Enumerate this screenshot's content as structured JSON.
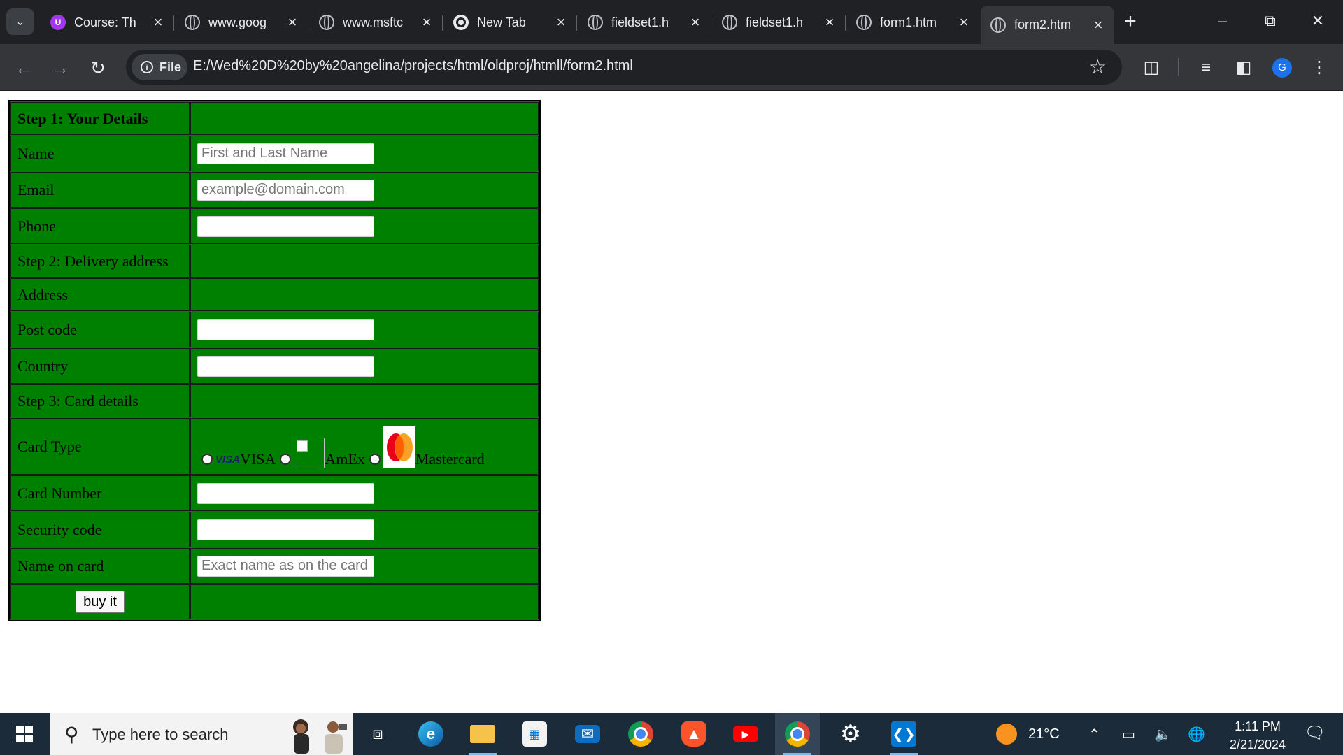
{
  "browser": {
    "tabs": [
      {
        "title": "Course: Th",
        "favicon": "udemy-icon"
      },
      {
        "title": "www.goog",
        "favicon": "globe-icon"
      },
      {
        "title": "www.msftc",
        "favicon": "globe-icon"
      },
      {
        "title": "New Tab",
        "favicon": "chrome-icon"
      },
      {
        "title": "fieldset1.h",
        "favicon": "globe-icon"
      },
      {
        "title": "fieldset1.h",
        "favicon": "globe-icon"
      },
      {
        "title": "form1.htm",
        "favicon": "globe-icon"
      },
      {
        "title": "form2.htm",
        "favicon": "globe-icon",
        "active": true
      }
    ],
    "new_tab_symbol": "+",
    "address": {
      "scheme_chip": "File",
      "url": "E:/Wed%20D%20by%20angelina/projects/html/oldproj/htmll/form2.html"
    },
    "profile_initial": "G"
  },
  "form": {
    "step1": "Step 1: Your Details",
    "name_label": "Name",
    "name_placeholder": "First and Last Name",
    "email_label": "Email",
    "email_placeholder": "example@domain.com",
    "phone_label": "Phone",
    "step2": "Step 2: Delivery address",
    "address_label": "Address",
    "postcode_label": "Post code",
    "country_label": "Country",
    "step3": "Step 3: Card details",
    "cardtype_label": "Card Type",
    "card_options": [
      {
        "label": "VISA",
        "logo_text": "VISA"
      },
      {
        "label": "AmEx"
      },
      {
        "label": "Mastercard"
      }
    ],
    "cardnumber_label": "Card Number",
    "security_label": "Security code",
    "nameoncard_label": "Name on card",
    "nameoncard_placeholder": "Exact name as on the card",
    "buy_label": "buy it"
  },
  "taskbar": {
    "search_placeholder": "Type here to search",
    "temperature": "21°C",
    "time": "1:11 PM",
    "date": "2/21/2024"
  },
  "colors": {
    "form_background": "#008000",
    "browser_frame": "#202124",
    "toolbar": "#35363a",
    "taskbar": "#1c2b3a"
  }
}
